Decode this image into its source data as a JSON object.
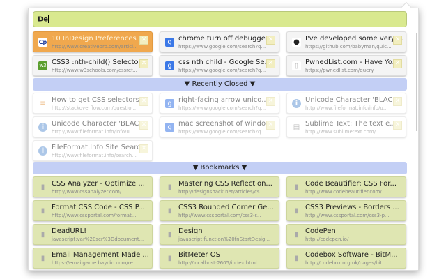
{
  "search": {
    "value": "De"
  },
  "open_tabs": [
    {
      "title": "10 InDesign Preferences ...",
      "url": "http://www.creativepro.com/articl...",
      "icon": "creativepro-icon",
      "selected": true
    },
    {
      "title": "chrome turn off debugge...",
      "url": "https://www.google.com/search?q...",
      "icon": "google-icon"
    },
    {
      "title": "I've developed some very ...",
      "url": "https://github.com/babyman/quic...",
      "icon": "github-icon"
    },
    {
      "title": "CSS3 :nth-child() Selector",
      "url": "http://www.w3schools.com/cssref...",
      "icon": "w3schools-icon"
    },
    {
      "title": "css nth child - Google Se...",
      "url": "https://www.google.com/search?q...",
      "icon": "google-icon"
    },
    {
      "title": "PwnedList.com - Have Yo...",
      "url": "https://pwnedlist.com/query",
      "icon": "page-icon"
    }
  ],
  "recently_closed": {
    "label": "▼ Recently Closed ▼",
    "items": [
      {
        "title": "How to get CSS selectors ...",
        "url": "http://stackoverflow.com/questio...",
        "icon": "stackoverflow-icon"
      },
      {
        "title": "right-facing arrow unico...",
        "url": "https://www.google.com/search?q...",
        "icon": "google-icon"
      },
      {
        "title": "Unicode Character 'BLAC...",
        "url": "http://www.fileformat.info/info/u...",
        "icon": "info-icon"
      },
      {
        "title": "Unicode Character 'BLAC...",
        "url": "http://www.fileformat.info/info/u...",
        "icon": "info-icon"
      },
      {
        "title": "mac screenshot of windo...",
        "url": "https://www.google.com/search?q...",
        "icon": "google-icon"
      },
      {
        "title": "Sublime Text: The text e...",
        "url": "http://www.sublimetext.com/",
        "icon": "sublime-icon"
      },
      {
        "title": "FileFormat.Info Site Search",
        "url": "http://www.fileformat.info/search...",
        "icon": "info-icon"
      }
    ]
  },
  "bookmarks": {
    "label": "▼ Bookmarks ▼",
    "items": [
      {
        "title": "CSS Analyzer - Optimize ...",
        "url": "http://www.cssanalyzer.com/"
      },
      {
        "title": "Mastering CSS Reflection...",
        "url": "http://designshack.net/articles/cs..."
      },
      {
        "title": "Code Beautifier: CSS For...",
        "url": "http://www.codebeautifier.com/"
      },
      {
        "title": "Format CSS Code - CSS P...",
        "url": "http://www.cssportal.com/format..."
      },
      {
        "title": "CSS3 Rounded Corner Ge...",
        "url": "http://www.cssportal.com/css3-r..."
      },
      {
        "title": "CSS3 Previews - Borders ...",
        "url": "http://www.cssportal.com/css3-p..."
      },
      {
        "title": "DeadURL!",
        "url": "javascript:var%20scr%3Ddocument..."
      },
      {
        "title": "Design",
        "url": "javascript:function%20fnStartDesig..."
      },
      {
        "title": "CodePen",
        "url": "http://codepen.io/"
      },
      {
        "title": "Email Management Made ...",
        "url": "https://emailgame.baydin.com/re..."
      },
      {
        "title": "BitMeter OS",
        "url": "http://localhost:2605/index.html"
      },
      {
        "title": "Codebox Software - BitM...",
        "url": "http://codebox.org.uk/pages/bit..."
      }
    ]
  },
  "colors": {
    "search_bg": "#d9e98f",
    "selected": "#f0a84e",
    "section": "#c3cff5",
    "bookmark": "#dfe6b2"
  }
}
